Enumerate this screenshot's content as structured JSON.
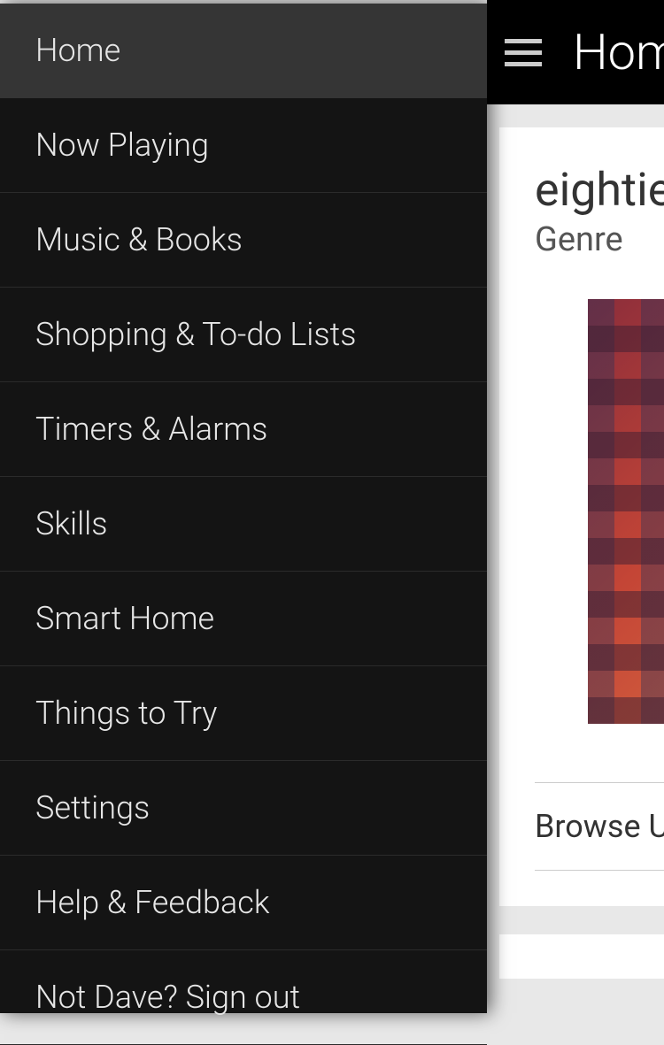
{
  "header": {
    "title": "Hom"
  },
  "sidebar": {
    "items": [
      {
        "label": "Home",
        "active": true
      },
      {
        "label": "Now Playing",
        "active": false
      },
      {
        "label": "Music & Books",
        "active": false
      },
      {
        "label": "Shopping & To-do Lists",
        "active": false
      },
      {
        "label": "Timers & Alarms",
        "active": false
      },
      {
        "label": "Skills",
        "active": false
      },
      {
        "label": "Smart Home",
        "active": false
      },
      {
        "label": "Things to Try",
        "active": false
      },
      {
        "label": "Settings",
        "active": false
      },
      {
        "label": "Help & Feedback",
        "active": false
      },
      {
        "label": "Not Dave? Sign out",
        "active": false
      }
    ]
  },
  "card": {
    "title": "eightie",
    "subtitle": "Genre",
    "browse_label": "Browse Un"
  }
}
